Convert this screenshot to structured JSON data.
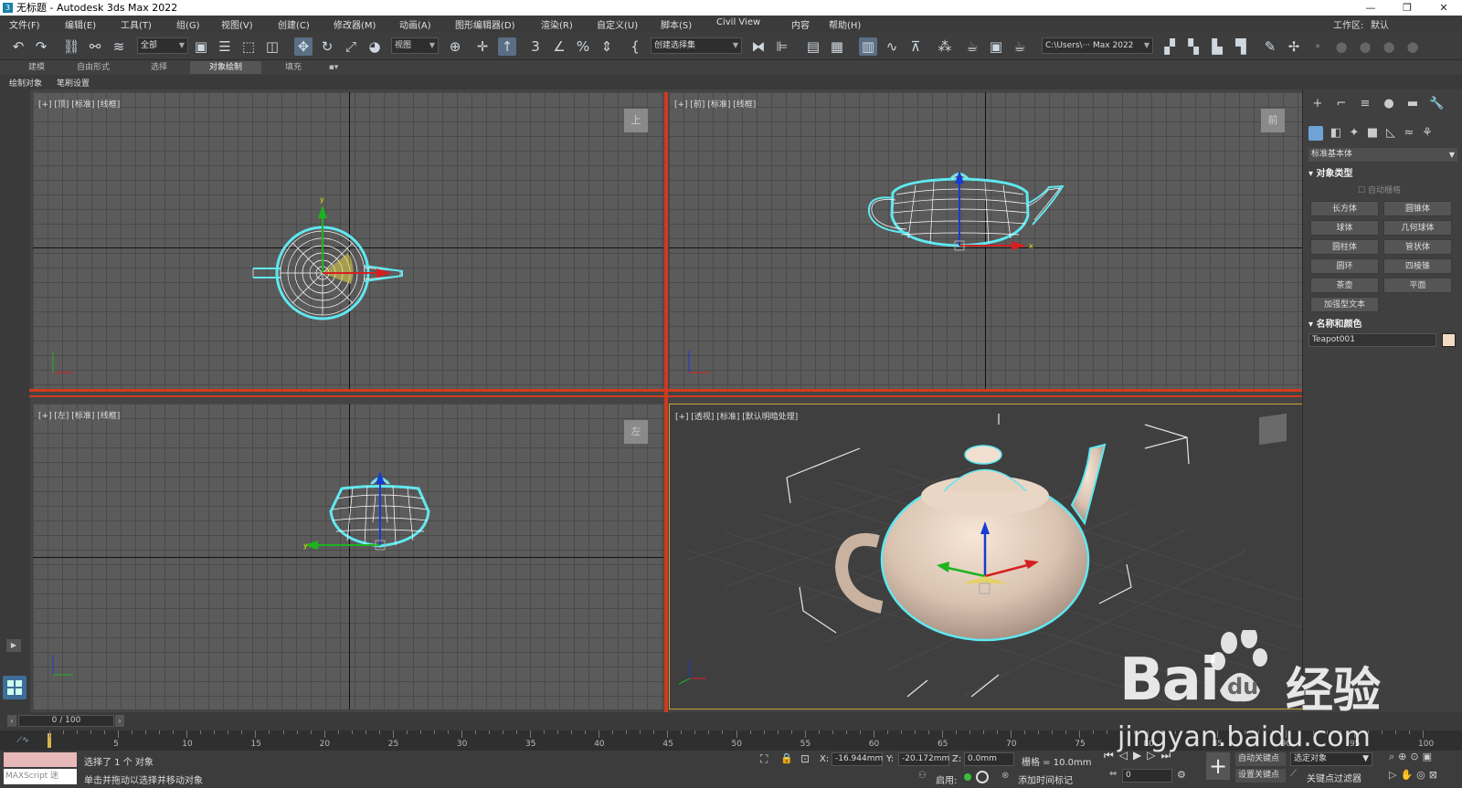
{
  "window": {
    "title": "无标题 - Autodesk 3ds Max 2022",
    "min": "—",
    "max": "❐",
    "close": "✕"
  },
  "menu": {
    "items": [
      "文件(F)",
      "编辑(E)",
      "工具(T)",
      "组(G)",
      "视图(V)",
      "创建(C)",
      "修改器(M)",
      "动画(A)",
      "图形编辑器(D)",
      "渲染(R)",
      "自定义(U)",
      "脚本(S)",
      "Civil View",
      "内容",
      "帮助(H)"
    ],
    "workspace_label": "工作区:",
    "workspace_value": "默认"
  },
  "toolbar": {
    "selection_filter": "全部",
    "ref_coord": "视图",
    "named_selection": "创建选择集",
    "project_path": "C:\\Users\\··· Max 2022"
  },
  "ribbon": {
    "tabs": [
      "建模",
      "自由形式",
      "选择",
      "对象绘制",
      "填充"
    ],
    "active_tab": "对象绘制",
    "sub_items": [
      "绘制对象",
      "笔刷设置"
    ]
  },
  "viewports": {
    "top": {
      "label": "[+] [顶] [标准] [线框]",
      "nav": "上"
    },
    "front": {
      "label": "[+] [前] [标准] [线框]",
      "nav": "前"
    },
    "left": {
      "label": "[+] [左] [标准] [线框]",
      "nav": "左"
    },
    "perspective": {
      "label": "[+] [透视] [标准] [默认明暗处理]"
    }
  },
  "command_panel": {
    "category": "标准基本体",
    "object_type_title": "对象类型",
    "auto_grid": "自动栅格",
    "buttons": [
      "长方体",
      "圆锥体",
      "球体",
      "几何球体",
      "圆柱体",
      "管状体",
      "圆环",
      "四棱锥",
      "茶壶",
      "平面",
      "加强型文本"
    ],
    "name_color_title": "名称和颜色",
    "object_name": "Teapot001",
    "object_color": "#f2dcc6"
  },
  "timeline": {
    "frame_display": "0 / 100",
    "ticks": [
      "5",
      "10",
      "15",
      "20",
      "25",
      "30",
      "35",
      "40",
      "45",
      "50",
      "55",
      "60",
      "65",
      "70",
      "75",
      "80",
      "85",
      "90",
      "95",
      "100"
    ]
  },
  "status": {
    "maxscript": "MAXScript 迷",
    "selected": "选择了 1 个 对象",
    "prompt": "单击并拖动以选择并移动对象",
    "x_label": "X:",
    "x_value": "-16.944mm",
    "y_label": "Y:",
    "y_value": "-20.172mm",
    "z_label": "Z:",
    "z_value": "0.0mm",
    "grid": "栅格 = 10.0mm",
    "enable": "启用:",
    "add_time_tag": "添加时间标记",
    "auto_key": "自动关键点",
    "set_key": "设置关键点",
    "selected_object": "选定对象",
    "key_filters": "关键点过滤器",
    "current_frame": "0"
  },
  "watermark": {
    "brand": "Bai",
    "paw": "du",
    "jingyan": "经验",
    "url": "jingyan.baidu.com"
  },
  "colors": {
    "separator": "#d13a1e",
    "selection": "#5fe8f0",
    "teapot": "#d9c2b0"
  }
}
